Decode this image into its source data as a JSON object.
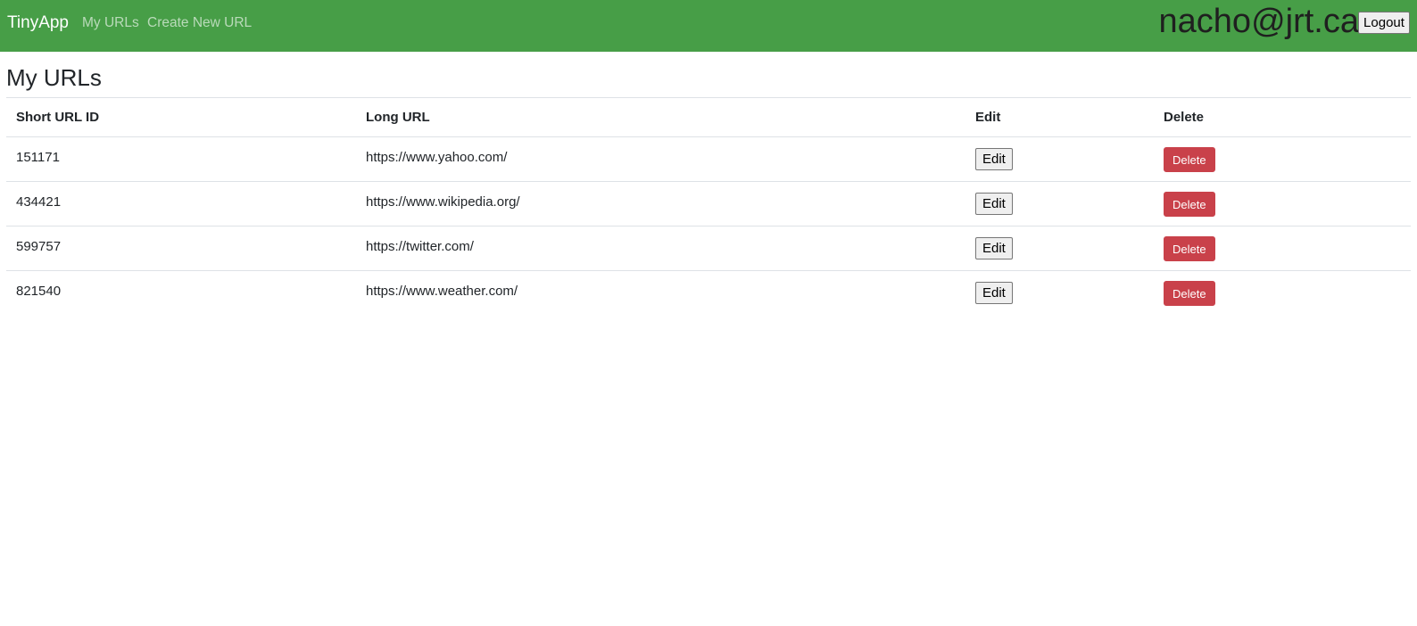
{
  "navbar": {
    "brand": "TinyApp",
    "links": [
      {
        "label": "My URLs"
      },
      {
        "label": "Create New URL"
      }
    ],
    "user_email": "nacho@jrt.ca",
    "logout_label": "Logout",
    "background_color": "#479e47"
  },
  "main": {
    "title": "My URLs",
    "table": {
      "headers": [
        "Short URL ID",
        "Long URL",
        "Edit",
        "Delete"
      ],
      "rows": [
        {
          "short_id": "151171",
          "long_url": "https://www.yahoo.com/",
          "edit_label": "Edit",
          "delete_label": "Delete"
        },
        {
          "short_id": "434421",
          "long_url": "https://www.wikipedia.org/",
          "edit_label": "Edit",
          "delete_label": "Delete"
        },
        {
          "short_id": "599757",
          "long_url": "https://twitter.com/",
          "edit_label": "Edit",
          "delete_label": "Delete"
        },
        {
          "short_id": "821540",
          "long_url": "https://www.weather.com/",
          "edit_label": "Edit",
          "delete_label": "Delete"
        }
      ]
    },
    "delete_color": "#c9414a"
  }
}
